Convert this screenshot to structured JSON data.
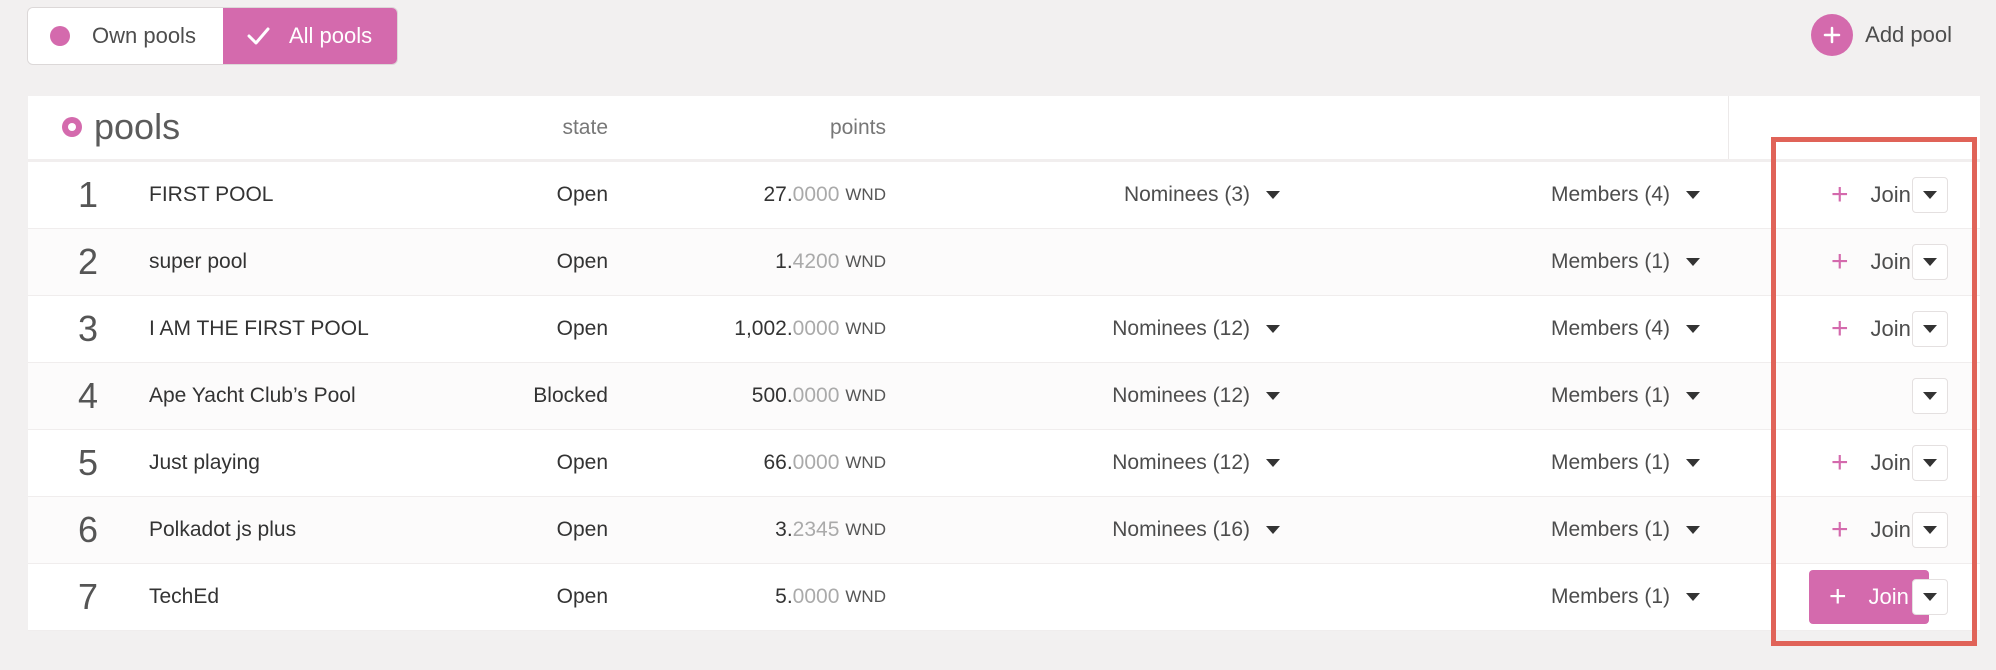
{
  "filters": {
    "own_label": "Own pools",
    "all_label": "All pools"
  },
  "add_pool_label": "Add pool",
  "table": {
    "title": "pools",
    "columns": {
      "state": "state",
      "points": "points"
    },
    "rows": [
      {
        "rank": "1",
        "name": "FIRST POOL",
        "state": "Open",
        "points_int": "27.",
        "points_dec": "0000",
        "unit": "WND",
        "nominees": "Nominees (3)",
        "members": "Members (4)",
        "join": "Join",
        "join_style": "plain"
      },
      {
        "rank": "2",
        "name": "super pool",
        "state": "Open",
        "points_int": "1.",
        "points_dec": "4200",
        "unit": "WND",
        "nominees": "",
        "members": "Members (1)",
        "join": "Join",
        "join_style": "plain"
      },
      {
        "rank": "3",
        "name": "I AM THE FIRST POOL",
        "state": "Open",
        "points_int": "1,002.",
        "points_dec": "0000",
        "unit": "WND",
        "nominees": "Nominees (12)",
        "members": "Members (4)",
        "join": "Join",
        "join_style": "plain"
      },
      {
        "rank": "4",
        "name": "Ape Yacht Club’s Pool",
        "state": "Blocked",
        "points_int": "500.",
        "points_dec": "0000",
        "unit": "WND",
        "nominees": "Nominees (12)",
        "members": "Members (1)",
        "join": "",
        "join_style": "none"
      },
      {
        "rank": "5",
        "name": "Just playing",
        "state": "Open",
        "points_int": "66.",
        "points_dec": "0000",
        "unit": "WND",
        "nominees": "Nominees (12)",
        "members": "Members (1)",
        "join": "Join",
        "join_style": "plain"
      },
      {
        "rank": "6",
        "name": "Polkadot js plus",
        "state": "Open",
        "points_int": "3.",
        "points_dec": "2345",
        "unit": "WND",
        "nominees": "Nominees (16)",
        "members": "Members (1)",
        "join": "Join",
        "join_style": "plain"
      },
      {
        "rank": "7",
        "name": "TechEd",
        "state": "Open",
        "points_int": "5.",
        "points_dec": "0000",
        "unit": "WND",
        "nominees": "",
        "members": "Members (1)",
        "join": "Join",
        "join_style": "primary"
      }
    ]
  },
  "colors": {
    "accent": "#d46aad",
    "highlight": "#e06358",
    "background": "#f2f0f0"
  }
}
